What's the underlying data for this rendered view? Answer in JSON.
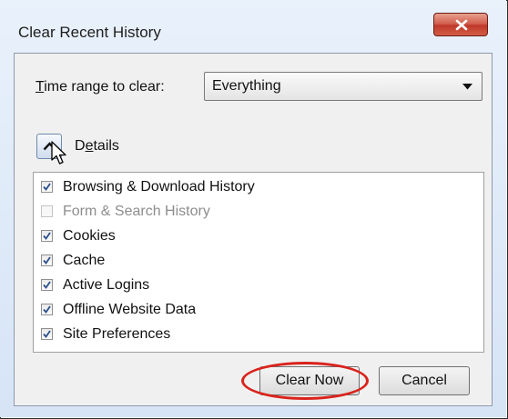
{
  "window": {
    "title": "Clear Recent History",
    "close_icon": "close-icon"
  },
  "time_range": {
    "label_mnemonic": "T",
    "label_rest": "ime range to clear:",
    "selected": "Everything"
  },
  "details": {
    "label_lead": "D",
    "label_mnemonic": "e",
    "label_rest": "tails",
    "expanded": true
  },
  "items": [
    {
      "label": "Browsing & Download History",
      "checked": true,
      "enabled": true
    },
    {
      "label": "Form & Search History",
      "checked": false,
      "enabled": false
    },
    {
      "label": "Cookies",
      "checked": true,
      "enabled": true
    },
    {
      "label": "Cache",
      "checked": true,
      "enabled": true
    },
    {
      "label": "Active Logins",
      "checked": true,
      "enabled": true
    },
    {
      "label": "Offline Website Data",
      "checked": true,
      "enabled": true
    },
    {
      "label": "Site Preferences",
      "checked": true,
      "enabled": true
    }
  ],
  "buttons": {
    "clear_now": "Clear Now",
    "cancel": "Cancel"
  },
  "colors": {
    "highlight_ring": "#d9231c",
    "close_button": "#c0392b",
    "check_mark": "#2b4f8c"
  }
}
